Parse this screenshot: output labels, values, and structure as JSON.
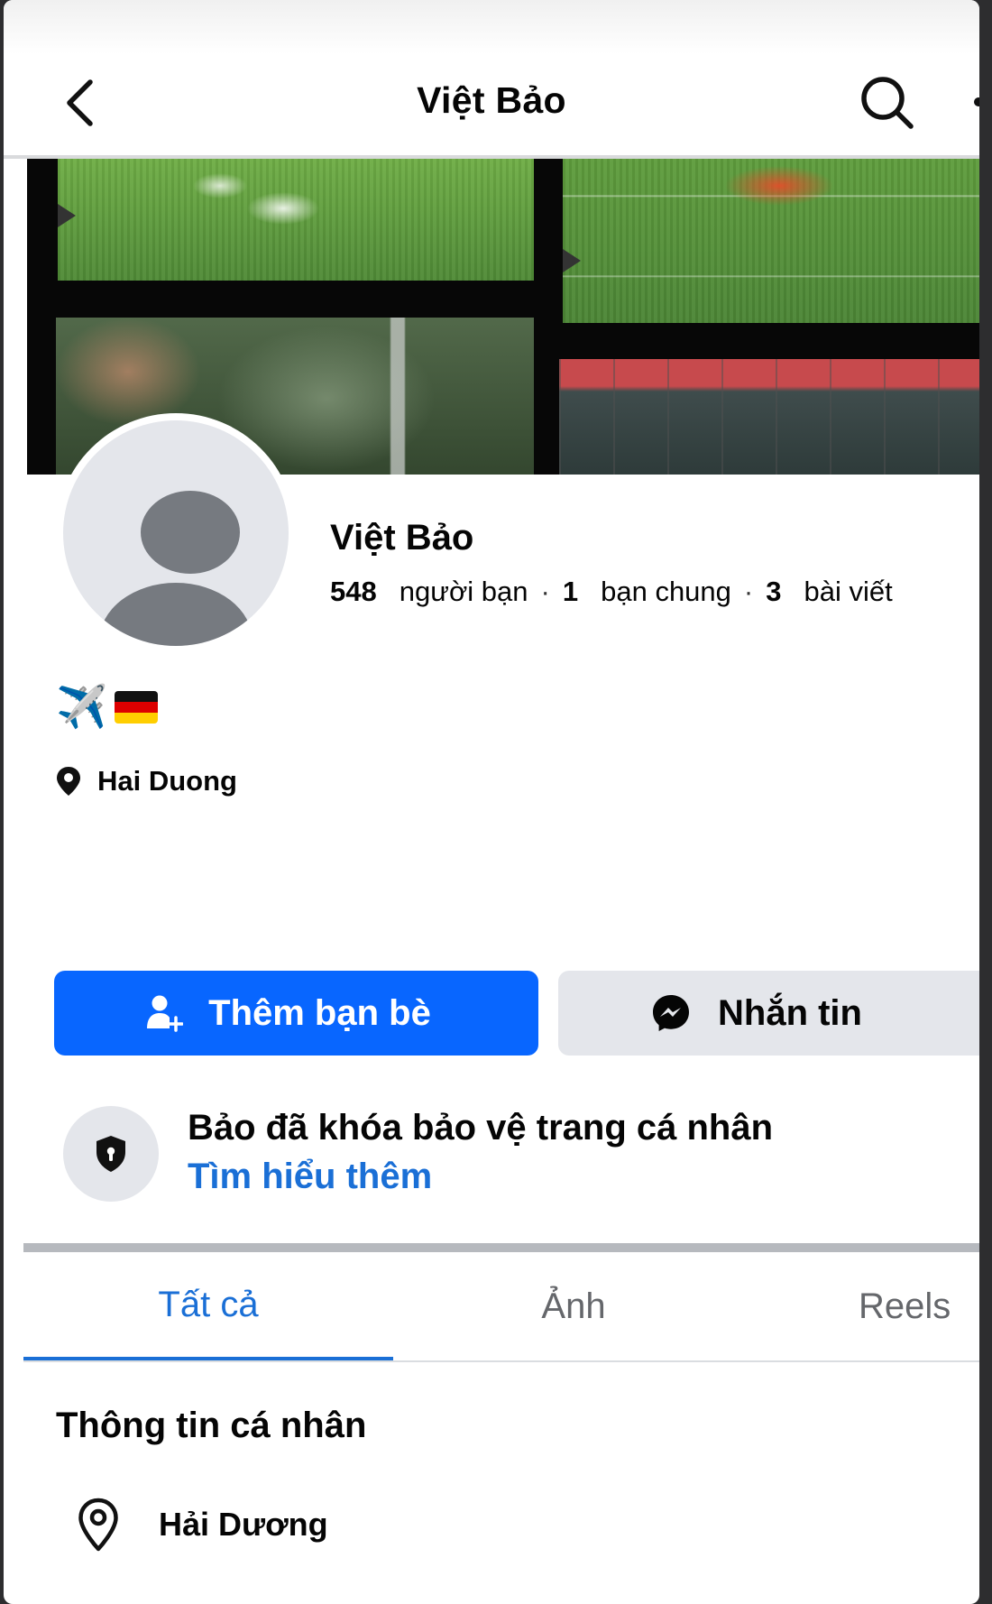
{
  "header": {
    "title": "Việt Bảo",
    "back_icon": "chevron-left-icon",
    "search_icon": "search-icon"
  },
  "profile": {
    "name": "Việt Bảo",
    "stats": {
      "friends_count": "548",
      "friends_label": "người bạn",
      "mutual_count": "1",
      "mutual_label": "bạn chung",
      "posts_count": "3",
      "posts_label": "bài viết",
      "separator": "·"
    },
    "bio": {
      "airplane_emoji": "✈️",
      "flag_emoji": "🇩🇪"
    },
    "location": "Hai Duong"
  },
  "actions": {
    "add_friend_label": "Thêm bạn bè",
    "message_label": "Nhắn tin"
  },
  "lock_notice": {
    "title": "Bảo đã khóa bảo vệ trang cá nhân",
    "link": "Tìm hiểu thêm"
  },
  "tabs": [
    {
      "label": "Tất cả",
      "active": true
    },
    {
      "label": "Ảnh",
      "active": false
    },
    {
      "label": "Reels",
      "active": false
    }
  ],
  "about": {
    "title": "Thông tin cá nhân",
    "location": "Hải Dương"
  },
  "colors": {
    "primary_blue": "#0866ff",
    "link_blue": "#1a6fd6",
    "button_grey": "#e4e6eb",
    "avatar_silhouette": "#767a80"
  }
}
